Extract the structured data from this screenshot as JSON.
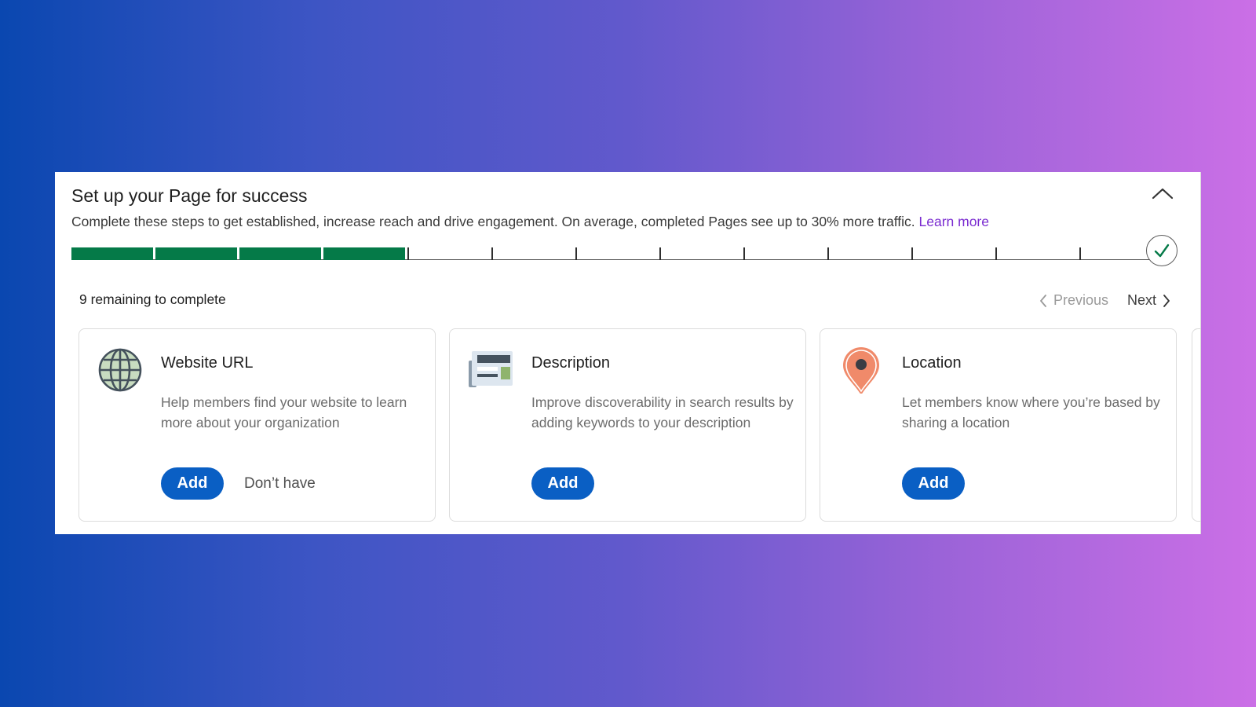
{
  "header": {
    "title": "Set up your Page for success",
    "subtitle": "Complete these steps to get established, increase reach and drive engagement. On average, completed Pages see up to 30% more traffic.",
    "learn_more": "Learn more"
  },
  "progress": {
    "completed_steps": 4,
    "total_steps": 13
  },
  "remaining_text": "9 remaining to complete",
  "pager": {
    "previous": "Previous",
    "next": "Next"
  },
  "cards": [
    {
      "icon": "globe-icon",
      "title": "Website URL",
      "description": "Help members find your website to learn more about your organization",
      "add_label": "Add",
      "secondary_label": "Don’t have"
    },
    {
      "icon": "newspaper-icon",
      "title": "Description",
      "description": "Improve discoverability in search results by adding keywords to your description",
      "add_label": "Add"
    },
    {
      "icon": "location-pin-icon",
      "title": "Location",
      "description": "Let members know where you’re based by sharing a location",
      "add_label": "Add"
    }
  ],
  "colors": {
    "progress_fill": "#057a48",
    "primary_button": "#0a5fc4",
    "link": "#7a2bd0",
    "pin": "#f08a6a"
  }
}
